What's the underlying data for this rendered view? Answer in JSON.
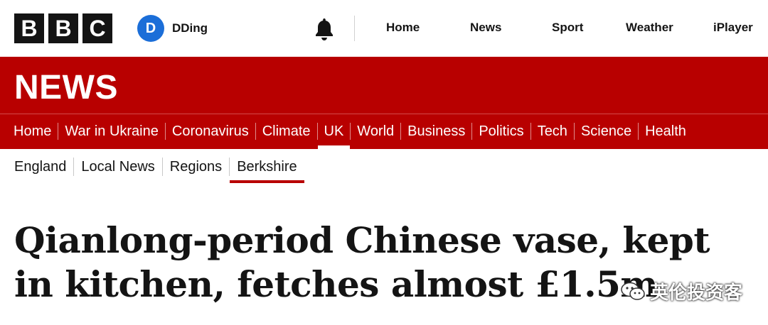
{
  "masthead": {
    "logo_letters": [
      "B",
      "B",
      "C"
    ],
    "account": {
      "initial": "D",
      "name": "DDing",
      "avatar_color": "#1b6ed8"
    },
    "notifications_icon": "bell-icon",
    "nav": [
      "Home",
      "News",
      "Sport",
      "Weather",
      "iPlayer"
    ]
  },
  "news_band": {
    "wordmark": "NEWS",
    "color": "#b80000",
    "primary_nav": [
      "Home",
      "War in Ukraine",
      "Coronavirus",
      "Climate",
      "UK",
      "World",
      "Business",
      "Politics",
      "Tech",
      "Science",
      "Health"
    ],
    "active": "UK"
  },
  "secondary_nav": {
    "items": [
      "England",
      "Local News",
      "Regions",
      "Berkshire"
    ],
    "active": "Berkshire"
  },
  "article": {
    "headline_line1": "Qianlong-period Chinese vase, kept",
    "headline_line2": "in kitchen, fetches almost £1.5m"
  },
  "watermark": {
    "icon": "wechat-icon",
    "text": "英伦投资客"
  }
}
